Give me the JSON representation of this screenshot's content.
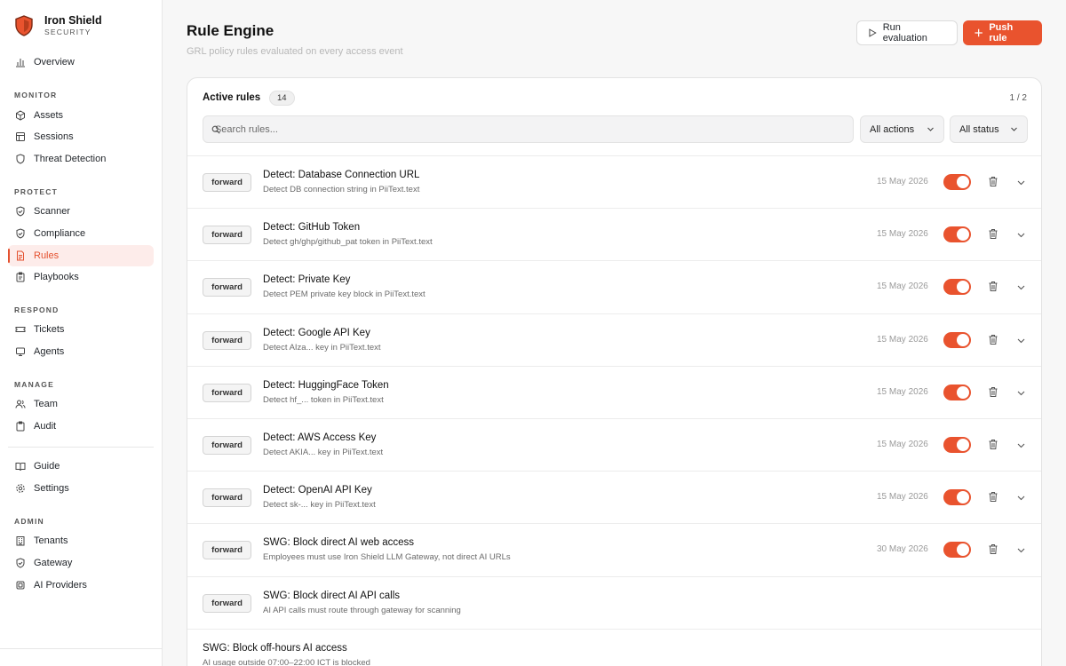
{
  "brand": {
    "name": "Iron Shield",
    "sub": "SECURITY"
  },
  "nav": {
    "overview": "Overview",
    "monitor_label": "MONITOR",
    "assets": "Assets",
    "sessions": "Sessions",
    "threat": "Threat Detection",
    "protect_label": "PROTECT",
    "scanner": "Scanner",
    "compliance": "Compliance",
    "rules": "Rules",
    "playbooks": "Playbooks",
    "respond_label": "RESPOND",
    "tickets": "Tickets",
    "agents": "Agents",
    "manage_label": "MANAGE",
    "team": "Team",
    "audit": "Audit",
    "guide": "Guide",
    "settings": "Settings",
    "admin_label": "ADMIN",
    "tenants": "Tenants",
    "gateway": "Gateway",
    "ai_providers": "AI Providers"
  },
  "header": {
    "title": "Rule Engine",
    "subtitle": "GRL policy rules evaluated on every access event",
    "run_label": "Run evaluation",
    "push_label": "Push rule"
  },
  "card": {
    "title": "Active rules",
    "count": "14",
    "page": "1 / 2",
    "search_placeholder": "Search rules...",
    "actions_select": "All actions",
    "status_select": "All status"
  },
  "rules": [
    {
      "action": "forward",
      "name": "Detect: Database Connection URL",
      "desc": "Detect DB connection string in PiiText.text",
      "date": "15 May 2026",
      "enabled": true
    },
    {
      "action": "forward",
      "name": "Detect: GitHub Token",
      "desc": "Detect gh/ghp/github_pat token in PiiText.text",
      "date": "15 May 2026",
      "enabled": true
    },
    {
      "action": "forward",
      "name": "Detect: Private Key",
      "desc": "Detect PEM private key block in PiiText.text",
      "date": "15 May 2026",
      "enabled": true
    },
    {
      "action": "forward",
      "name": "Detect: Google API Key",
      "desc": "Detect AIza... key in PiiText.text",
      "date": "15 May 2026",
      "enabled": true
    },
    {
      "action": "forward",
      "name": "Detect: HuggingFace Token",
      "desc": "Detect hf_... token in PiiText.text",
      "date": "15 May 2026",
      "enabled": true
    },
    {
      "action": "forward",
      "name": "Detect: AWS Access Key",
      "desc": "Detect AKIA... key in PiiText.text",
      "date": "15 May 2026",
      "enabled": true
    },
    {
      "action": "forward",
      "name": "Detect: OpenAI API Key",
      "desc": "Detect sk-... key in PiiText.text",
      "date": "15 May 2026",
      "enabled": true
    },
    {
      "action": "forward",
      "name": "SWG: Block direct AI web access",
      "desc": "Employees must use Iron Shield LLM Gateway, not direct AI URLs",
      "date": "30 May 2026",
      "enabled": true
    },
    {
      "action": "forward",
      "name": "SWG: Block direct AI API calls",
      "desc": "AI API calls must route through gateway for scanning"
    },
    {
      "name": "SWG: Block off-hours AI access",
      "desc": "AI usage outside 07:00–22:00 ICT is blocked"
    }
  ]
}
